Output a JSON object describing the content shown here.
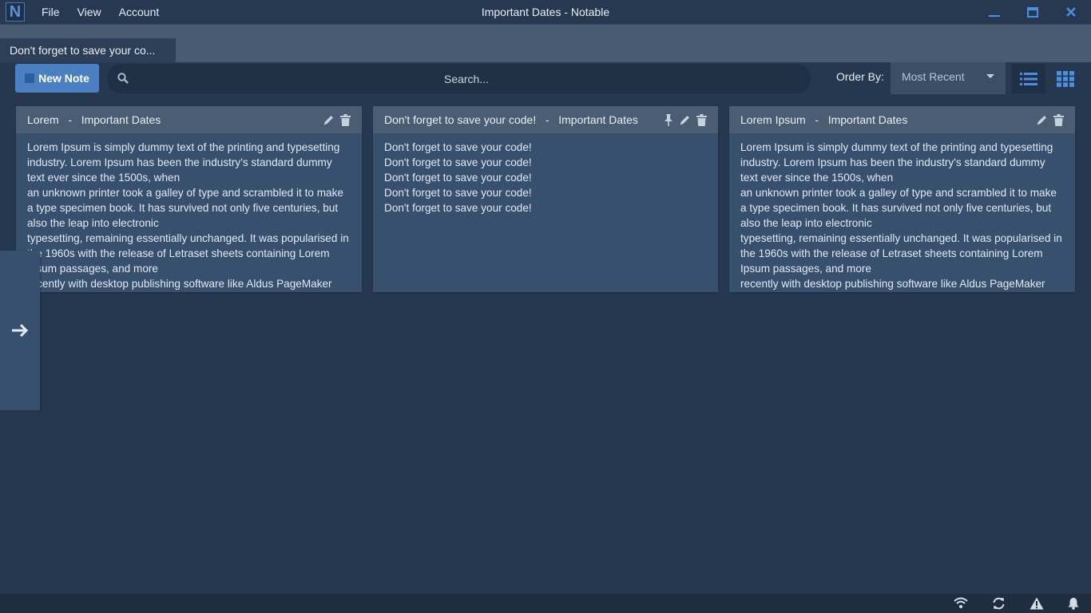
{
  "app": {
    "logo_letter": "N",
    "title": "Important Dates - Notable",
    "menu": [
      "File",
      "View",
      "Account"
    ]
  },
  "tabs": [
    {
      "label": "Don't forget to save your co..."
    }
  ],
  "toolbar": {
    "new_note_label": "New Note",
    "search_placeholder": "Search...",
    "order_by_label": "Order By:",
    "order_by_value": "Most Recent"
  },
  "notes": [
    {
      "title": "Lorem",
      "notebook": "Important Dates",
      "pinned": false,
      "lines": [
        "Lorem Ipsum is simply dummy text of the printing and typesetting industry. Lorem Ipsum has been the industry's standard dummy text ever since the 1500s, when",
        "an unknown printer took a galley of type and scrambled it to make a type specimen book. It has survived not only five centuries, but also the leap into electronic",
        "typesetting, remaining essentially unchanged. It was popularised in the 1960s with the release of Letraset sheets containing Lorem Ipsum passages, and more",
        "recently with desktop publishing software like Aldus PageMaker"
      ]
    },
    {
      "title": "Don't forget to save your code!",
      "notebook": "Important Dates",
      "pinned": true,
      "lines": [
        "Don't forget to save your code!",
        "Don't forget to save your code!",
        "Don't forget to save your code!",
        "Don't forget to save your code!",
        "Don't forget to save your code!"
      ]
    },
    {
      "title": "Lorem Ipsum",
      "notebook": "Important Dates",
      "pinned": false,
      "lines": [
        "Lorem Ipsum is simply dummy text of the printing and typesetting industry. Lorem Ipsum has been the industry's standard dummy text ever since the 1500s, when",
        "an unknown printer took a galley of type and scrambled it to make a type specimen book. It has survived not only five centuries, but also the leap into electronic",
        "typesetting, remaining essentially unchanged. It was popularised in the 1960s with the release of Letraset sheets containing Lorem Ipsum passages, and more",
        "recently with desktop publishing software like Aldus PageMaker"
      ]
    }
  ],
  "colors": {
    "background": "#263850",
    "card": "#37506e",
    "card_header": "#4b5d73",
    "accent": "#4a80c2"
  },
  "statusbar_icons": [
    "wifi-icon",
    "sync-icon",
    "warning-icon",
    "bell-icon"
  ]
}
